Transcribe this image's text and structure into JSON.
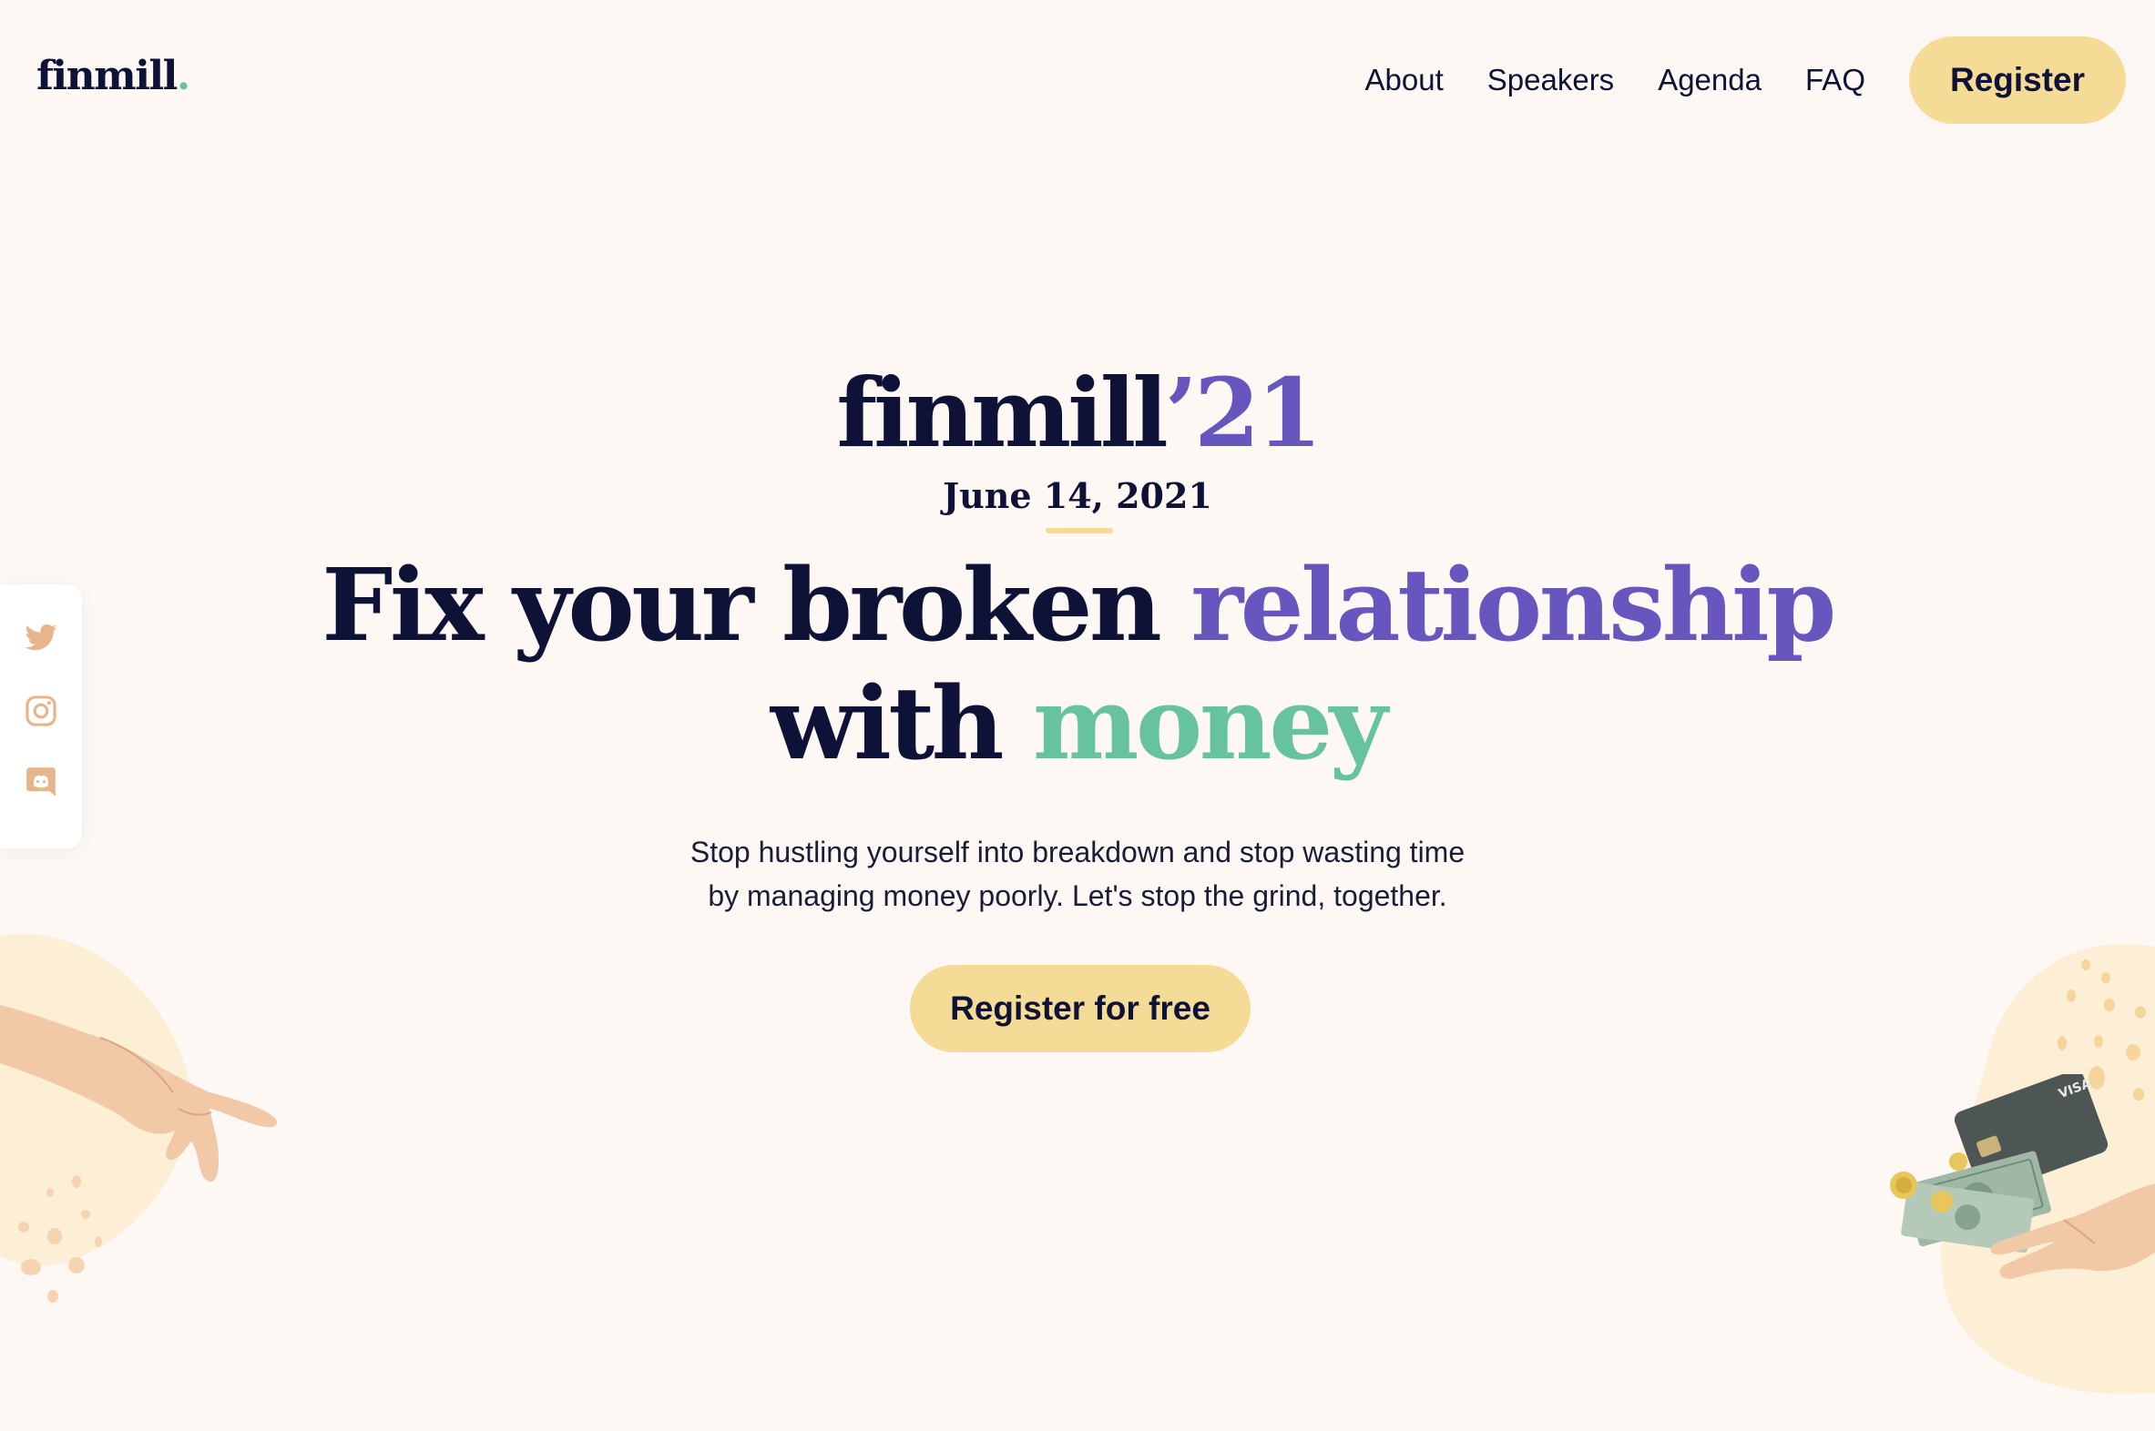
{
  "brand": {
    "logo_text": "finmill",
    "logo_dot": "."
  },
  "nav": {
    "items": [
      {
        "label": "About"
      },
      {
        "label": "Speakers"
      },
      {
        "label": "Agenda"
      },
      {
        "label": "FAQ"
      }
    ],
    "register_label": "Register"
  },
  "hero": {
    "event_name": "finmill",
    "event_year": "’21",
    "date": "June 14, 2021",
    "headline_part1": "Fix your broken ",
    "headline_part2": "relationship",
    "headline_part3": "with ",
    "headline_part4": "money",
    "subtext_line1": "Stop hustling yourself into breakdown and stop wasting time",
    "subtext_line2": "by managing money poorly. Let's stop the grind, together.",
    "cta_label": "Register for free",
    "card_text": "VISA"
  },
  "social": {
    "icons": [
      "twitter-icon",
      "instagram-icon",
      "discord-icon"
    ]
  },
  "colors": {
    "background": "#fdf8f4",
    "navy": "#0e1236",
    "purple": "#6656be",
    "green": "#67c2a0",
    "button_yellow": "#f5dc96",
    "social_icon": "#e8b48a",
    "blob": "#fcefd6"
  }
}
